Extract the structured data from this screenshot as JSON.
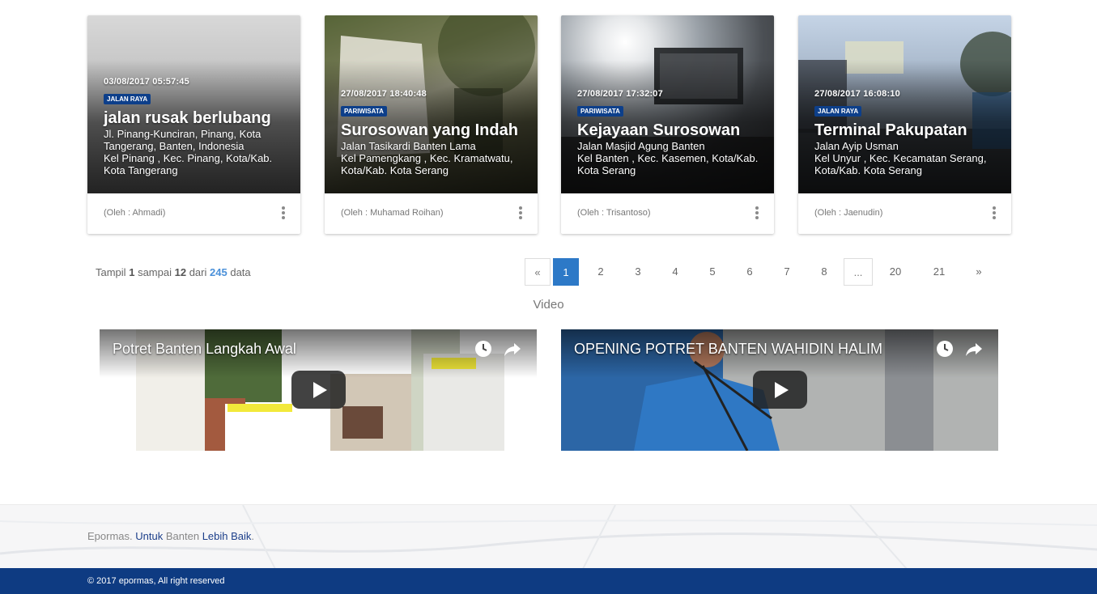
{
  "reports": [
    {
      "datetime": "03/08/2017 05:57:45",
      "category": "JALAN RAYA",
      "title": "jalan rusak berlubang",
      "address_lines": [
        "Jl. Pinang-Kunciran, Pinang, Kota",
        "Tangerang, Banten, Indonesia",
        "Kel Pinang , Kec. Pinang, Kota/Kab.",
        "Kota Tangerang"
      ],
      "author": "(Oleh : Ahmadi)"
    },
    {
      "datetime": "27/08/2017 18:40:48",
      "category": "PARIWISATA",
      "title": "Surosowan yang Indah",
      "address_lines": [
        "Jalan Tasikardi Banten Lama",
        "Kel Pamengkang , Kec. Kramatwatu,",
        "Kota/Kab. Kota Serang"
      ],
      "author": "(Oleh : Muhamad Roihan)"
    },
    {
      "datetime": "27/08/2017 17:32:07",
      "category": "PARIWISATA",
      "title": "Kejayaan Surosowan",
      "address_lines": [
        "Jalan Masjid Agung Banten",
        "Kel Banten , Kec. Kasemen, Kota/Kab.",
        "Kota Serang"
      ],
      "author": "(Oleh : Trisantoso)"
    },
    {
      "datetime": "27/08/2017 16:08:10",
      "category": "JALAN RAYA",
      "title": "Terminal Pakupatan",
      "address_lines": [
        "Jalan Ayip Usman",
        "Kel Unyur , Kec. Kecamatan Serang,",
        "Kota/Kab. Kota Serang"
      ],
      "author": "(Oleh : Jaenudin)"
    }
  ],
  "summary": {
    "prefix": "Tampil",
    "from": "1",
    "mid": "sampai",
    "to": "12",
    "of": "dari",
    "total": "245",
    "suffix": "data"
  },
  "pagination": {
    "prev": "«",
    "pages": [
      "1",
      "2",
      "3",
      "4",
      "5",
      "6",
      "7",
      "8",
      "...",
      "20",
      "21"
    ],
    "active": "1",
    "next": "»"
  },
  "video_section": {
    "heading": "Video",
    "videos": [
      {
        "title": "Potret Banten Langkah Awal"
      },
      {
        "title": "OPENING POTRET BANTEN WAHIDIN HALIM"
      }
    ]
  },
  "footer": {
    "brand": "Epormas.",
    "word1": "Untuk",
    "word2": "Banten",
    "word3": "Lebih Baik",
    "dot": ".",
    "copyright": "© 2017 epormas, All right reserved"
  },
  "colors": {
    "badge": "#0d3f8a",
    "pager_active": "#2d79c7",
    "total_count": "#4a90d9",
    "footer_bar": "#0e3b82"
  },
  "icons": [
    "more-vertical-icon",
    "watch-later-icon",
    "share-icon",
    "play-icon"
  ]
}
